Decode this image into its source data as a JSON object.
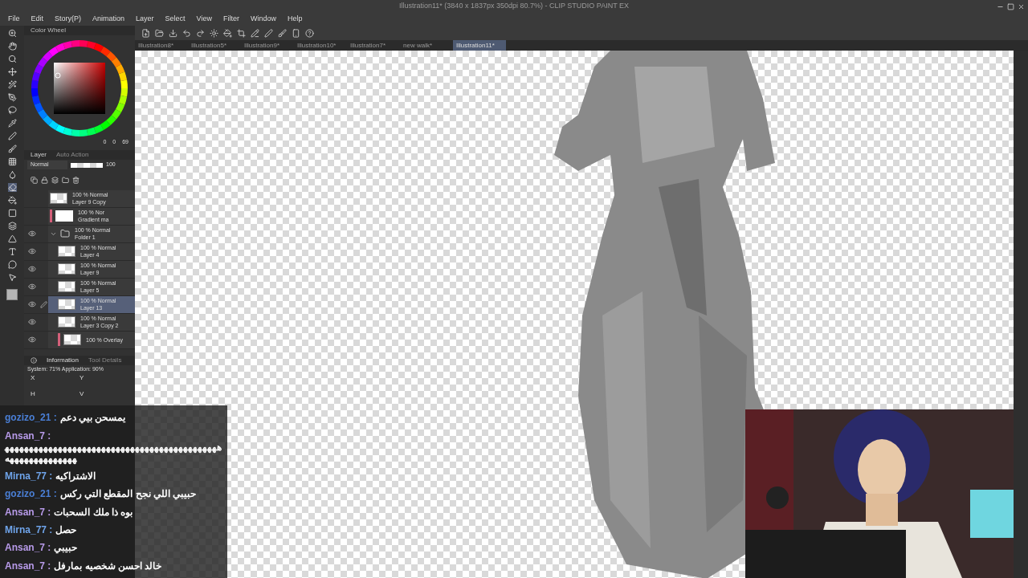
{
  "window": {
    "title": "Illustration11* (3840 x 1837px 350dpi 80.7%) - CLIP STUDIO PAINT EX"
  },
  "menu": [
    "File",
    "Edit",
    "Story(P)",
    "Animation",
    "Layer",
    "Select",
    "View",
    "Filter",
    "Window",
    "Help"
  ],
  "tabs": [
    {
      "label": "Illustration8*",
      "selected": false
    },
    {
      "label": "Illustration5*",
      "selected": false
    },
    {
      "label": "Illustration9*",
      "selected": false
    },
    {
      "label": "Illustration10*",
      "selected": false
    },
    {
      "label": "Illustration7*",
      "selected": false
    },
    {
      "label": "new walk*",
      "selected": false
    },
    {
      "label": "Illustration11*",
      "selected": true
    }
  ],
  "color_wheel": {
    "title": "Color Wheel",
    "readouts": [
      "0",
      "0",
      "69"
    ]
  },
  "layer_panel": {
    "title": "Layer",
    "tab_2": "Auto Action",
    "blend_mode": "Normal",
    "opacity_slider": {
      "level": 1
    },
    "opacity": "100",
    "layers": [
      {
        "kind": "layer",
        "status": "100 % Normal",
        "name": "Layer 9 Copy",
        "visible": false,
        "selected": false
      },
      {
        "kind": "gradient",
        "status": "100 % Nor",
        "name": "Gradient ma",
        "visible": false,
        "selected": false
      },
      {
        "kind": "folder",
        "status": "100 % Normal",
        "name": "Folder 1",
        "visible": true,
        "selected": false,
        "expanded": true,
        "children": [
          {
            "kind": "layer",
            "status": "100 % Normal",
            "name": "Layer 4",
            "visible": true,
            "selected": false
          },
          {
            "kind": "layer",
            "status": "100 % Normal",
            "name": "Layer 9",
            "visible": true,
            "selected": false
          },
          {
            "kind": "layer",
            "status": "100 % Normal",
            "name": "Layer 5",
            "visible": true,
            "selected": false
          },
          {
            "kind": "layer",
            "status": "100 % Normal",
            "name": "Layer 13",
            "visible": true,
            "selected": true
          },
          {
            "kind": "layer",
            "status": "100 % Normal",
            "name": "Layer 3 Copy 2",
            "visible": true,
            "selected": false
          },
          {
            "kind": "clipped",
            "status": "100 % Overlay",
            "visible": true,
            "selected": false
          }
        ]
      }
    ]
  },
  "info_panel": {
    "title": "Information",
    "tab_2": "Tool Details",
    "stats": "System: 71%  Application: 90%",
    "fields": [
      "X",
      "Y",
      "H",
      "V"
    ]
  },
  "chat": [
    {
      "user": "gozizo_21 :",
      "color": "#4a7fd6",
      "text": "يمسحن بيي دعم"
    },
    {
      "user": "Ansan_7 :",
      "color": "#b79ae8",
      "text": "هههههههههههههههههههههههههههههههههههههههههههههههههههههههههههه"
    },
    {
      "user": "Mirna_77 :",
      "color": "#6fa4ea",
      "text": "الاشتراكيه"
    },
    {
      "user": "gozizo_21 :",
      "color": "#4a7fd6",
      "text": "حبيبي اللي نجح المقطع التي ركس"
    },
    {
      "user": "Ansan_7 :",
      "color": "#b79ae8",
      "text": "بوه ذا ملك السحبات"
    },
    {
      "user": "Mirna_77 :",
      "color": "#6fa4ea",
      "text": "حصل"
    },
    {
      "user": "Ansan_7 :",
      "color": "#b79ae8",
      "text": "حبيبي"
    },
    {
      "user": "Ansan_7 :",
      "color": "#b79ae8",
      "text": "خالد احسن شخصيه بمارفل"
    }
  ]
}
